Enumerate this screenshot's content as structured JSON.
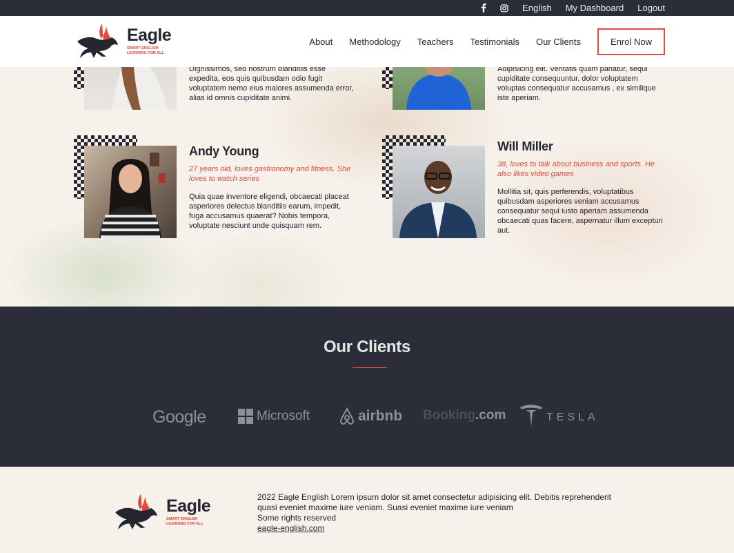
{
  "topbar": {
    "icons": [
      "facebook-icon",
      "instagram-icon"
    ],
    "links": [
      "English",
      "My Dashboard",
      "Logout"
    ]
  },
  "brand": {
    "name": "Eagle",
    "tagline_1": "SMART ENGLISH",
    "tagline_2": "LEARNING FOR ALL",
    "accent": "#e24b3b",
    "dark": "#2b2e38"
  },
  "nav": {
    "items": [
      "About",
      "Methodology",
      "Teachers",
      "Testimonials",
      "Our Clients"
    ],
    "cta": "Enrol Now"
  },
  "teachers": {
    "partial_left_bio": "Dignissimos, sed nostrum blanditiis esse expedita, eos quis quibusdam odio fugit voluptatem nemo eius maiores assumenda error, alias id omnis cupiditate animi.",
    "partial_right_bio": "Adipisicing elit. Veritatis quam pariatur, sequi cupiditate consequuntur, dolor voluptatem voluptas consequatur accusamus , ex similique iste aperiam.",
    "andy": {
      "name": "Andy Young",
      "subtitle": "27 years old, loves gastronomy and fitness. She loves to watch series",
      "bio": "Quia quae inventore eligendi, obcaecati placeat asperiores delectus blanditiis earum, impedit, fuga accusamus quaerat? Nobis tempora, voluptate nesciunt unde quisquam rem."
    },
    "will": {
      "name": "Will Miller",
      "subtitle": "38, loves to talk about business and sports. He also likes video games",
      "bio": "Mollitia sit, quis perferendis, voluptatibus quibusdam asperiores veniam accusamus consequatur sequi iusto aperiam assumenda obcaecati quas facere, aspernatur illum excepturi aut."
    }
  },
  "clients": {
    "title": "Our Clients",
    "logos": {
      "google": "Google",
      "microsoft": "Microsoft",
      "airbnb": "airbnb",
      "booking_1": "Booking",
      "booking_2": ".com",
      "tesla": "TESLA"
    }
  },
  "footer": {
    "text": "2022 Eagle English Lorem ipsum dolor sit amet consectetur adipisicing elit. Debitis reprehenderit quasi eveniet maxime iure veniam. Suasi eveniet maxime iure veniam",
    "rights": "Some rights reserved",
    "link": "eagle-english.com"
  }
}
